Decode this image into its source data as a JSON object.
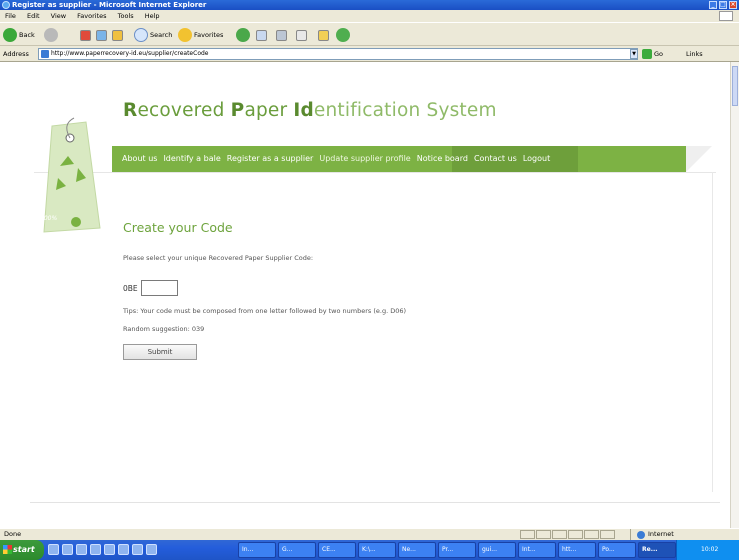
{
  "window": {
    "title": "Register as supplier - Microsoft Internet Explorer"
  },
  "menu": [
    "File",
    "Edit",
    "View",
    "Favorites",
    "Tools",
    "Help"
  ],
  "toolbar": {
    "back": "Back",
    "search": "Search",
    "favorites": "Favorites"
  },
  "address": {
    "label": "Address",
    "url": "http://www.paperrecovery-id.eu/supplier/createCode",
    "go": "Go",
    "links": "Links"
  },
  "site": {
    "logo": {
      "r": "R",
      "ecovered": "ecovered ",
      "p": "P",
      "aper": "aper ",
      "id": "Id",
      "entification": "entification System"
    },
    "nav": [
      "About us",
      "Identify a bale",
      "Register as a supplier",
      "Update supplier profile",
      "Notice board",
      "Contact us",
      "Logout"
    ],
    "tag_text": "100%"
  },
  "form": {
    "heading": "Create your Code",
    "instruction": "Please select your unique Recovered Paper Supplier Code:",
    "prefix": "0BE",
    "code_value": "",
    "tips": "Tips: Your code must be composed from one letter followed by two numbers (e.g. D06)",
    "random": "Random suggestion: 039",
    "submit": "Submit"
  },
  "status": {
    "text": "Done",
    "zone": "Internet"
  },
  "taskbar": {
    "start": "start",
    "tasks": [
      "In...",
      "G...",
      "CE...",
      "K:\\...",
      "Ne...",
      "Pr...",
      "gui...",
      "Int...",
      "htt...",
      "Po...",
      "Re..."
    ],
    "clock": "10:02"
  },
  "colors": {
    "brand_green": "#7db244",
    "heading_green": "#6da33c"
  }
}
